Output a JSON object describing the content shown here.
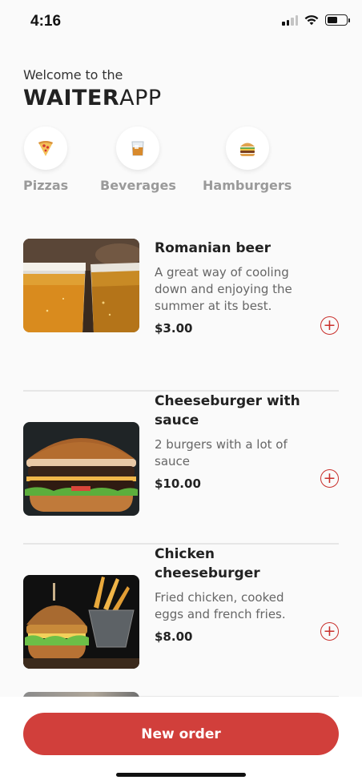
{
  "status_bar": {
    "time": "4:16"
  },
  "header": {
    "welcome": "Welcome to the",
    "brand_bold": "WAITER",
    "brand_light": "APP"
  },
  "categories": [
    {
      "label": "Pizzas",
      "icon": "pizza-icon",
      "glyph": "🍕"
    },
    {
      "label": "Beverages",
      "icon": "beverage-icon",
      "glyph": "🥃"
    },
    {
      "label": "Hamburgers",
      "icon": "hamburger-icon",
      "glyph": "🍔"
    }
  ],
  "products": [
    {
      "name": "Romanian beer",
      "description": "A great way of cooling down and enjoying the summer at its best.",
      "price": "$3.00"
    },
    {
      "name": "Cheeseburger with sauce",
      "description": "2 burgers with a lot of sauce",
      "price": "$10.00"
    },
    {
      "name": "Chicken cheeseburger",
      "description": "Fried chicken, cooked eggs and french fries.",
      "price": "$8.00"
    }
  ],
  "add_label": "+",
  "actions": {
    "new_order": "New order"
  },
  "colors": {
    "accent": "#d13f3b",
    "background": "#fafafa"
  }
}
